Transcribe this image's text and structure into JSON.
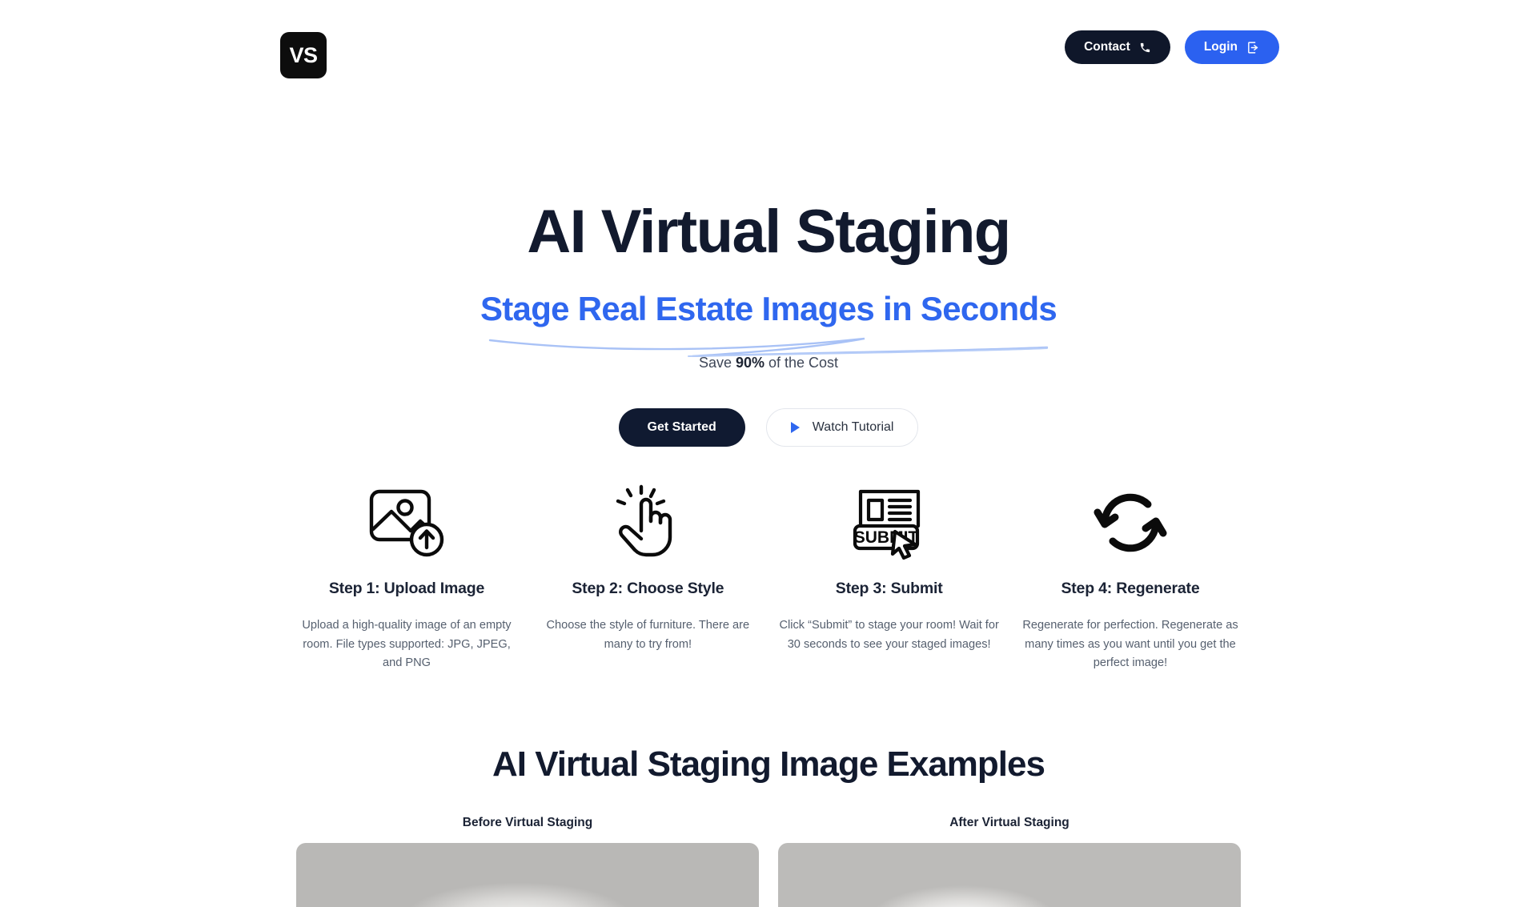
{
  "header": {
    "logo_text": "VS",
    "logo_icon": "vs-logo-icon",
    "contact_label": "Contact",
    "contact_icon": "phone-icon",
    "login_label": "Login",
    "login_icon": "login-arrow-icon",
    "contact_bg": "#0f172a",
    "login_bg": "#2b61f0"
  },
  "hero": {
    "title": "AI Virtual Staging",
    "subtitle": "Stage Real Estate Images in Seconds",
    "subtitle_color": "#2f67ef",
    "savings_prefix": "Save ",
    "savings_value": "90%",
    "savings_suffix": " of the Cost",
    "cta_primary": "Get Started",
    "cta_secondary": "Watch Tutorial",
    "cta_secondary_icon": "play-icon"
  },
  "steps": [
    {
      "icon": "image-upload-icon",
      "title": "Step 1: Upload Image",
      "desc": "Upload a high-quality image of an empty room. File types supported: JPG, JPEG, and PNG"
    },
    {
      "icon": "pointing-hand-click-icon",
      "title": "Step 2: Choose Style",
      "desc": "Choose the style of furniture. There are many to try from!"
    },
    {
      "icon": "submit-form-cursor-icon",
      "title": "Step 3: Submit",
      "desc": "Click “Submit” to stage your room! Wait for 30 seconds to see your staged images!"
    },
    {
      "icon": "regenerate-refresh-icon",
      "title": "Step 4: Regenerate",
      "desc": "Regenerate for perfection. Regenerate as many times as you want until you get the perfect image!"
    }
  ],
  "examples": {
    "title": "AI Virtual Staging Image Examples",
    "before_label": "Before Virtual Staging",
    "after_label": "After Virtual Staging"
  }
}
